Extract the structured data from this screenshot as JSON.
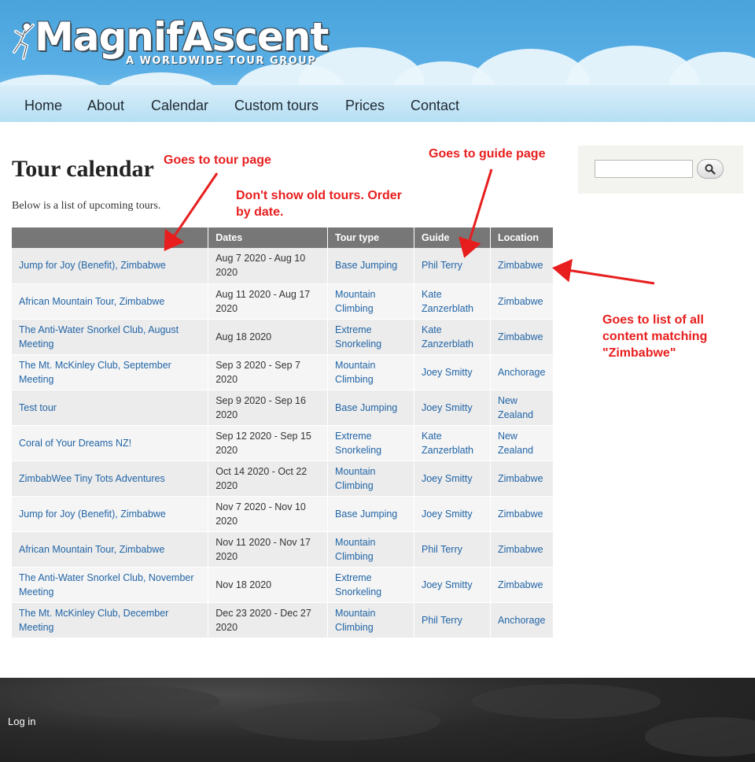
{
  "site": {
    "logo_text": "MagnifAscent",
    "tagline": "A WORLDWIDE TOUR GROUP"
  },
  "nav": [
    "Home",
    "About",
    "Calendar",
    "Custom tours",
    "Prices",
    "Contact"
  ],
  "page": {
    "title": "Tour calendar",
    "intro": "Below is a list of upcoming tours."
  },
  "table": {
    "headers": [
      "",
      "Dates",
      "Tour type",
      "Guide",
      "Location"
    ],
    "rows": [
      {
        "title": "Jump for Joy (Benefit), Zimbabwe",
        "dates": "Aug 7 2020 - Aug 10 2020",
        "type": "Base Jumping",
        "guide": "Phil Terry",
        "location": "Zimbabwe"
      },
      {
        "title": "African Mountain Tour, Zimbabwe",
        "dates": "Aug 11 2020 - Aug 17 2020",
        "type": "Mountain Climbing",
        "guide": "Kate Zanzerblath",
        "location": "Zimbabwe"
      },
      {
        "title": "The Anti-Water Snorkel Club, August Meeting",
        "dates": "Aug 18 2020",
        "type": "Extreme Snorkeling",
        "guide": "Kate Zanzerblath",
        "location": "Zimbabwe"
      },
      {
        "title": "The Mt. McKinley Club, September Meeting",
        "dates": "Sep 3 2020 - Sep 7 2020",
        "type": "Mountain Climbing",
        "guide": "Joey Smitty",
        "location": "Anchorage"
      },
      {
        "title": "Test tour",
        "dates": "Sep 9 2020 - Sep 16 2020",
        "type": "Base Jumping",
        "guide": "Joey Smitty",
        "location": "New Zealand"
      },
      {
        "title": "Coral of Your Dreams NZ!",
        "dates": "Sep 12 2020 - Sep 15 2020",
        "type": "Extreme Snorkeling",
        "guide": "Kate Zanzerblath",
        "location": "New Zealand"
      },
      {
        "title": "ZimbabWee Tiny Tots Adventures",
        "dates": "Oct 14 2020 - Oct 22 2020",
        "type": "Mountain Climbing",
        "guide": "Joey Smitty",
        "location": "Zimbabwe"
      },
      {
        "title": "Jump for Joy (Benefit), Zimbabwe",
        "dates": "Nov 7 2020 - Nov 10 2020",
        "type": "Base Jumping",
        "guide": "Joey Smitty",
        "location": "Zimbabwe"
      },
      {
        "title": "African Mountain Tour, Zimbabwe",
        "dates": "Nov 11 2020 - Nov 17 2020",
        "type": "Mountain Climbing",
        "guide": "Phil Terry",
        "location": "Zimbabwe"
      },
      {
        "title": "The Anti-Water Snorkel Club, November Meeting",
        "dates": "Nov 18 2020",
        "type": "Extreme Snorkeling",
        "guide": "Joey Smitty",
        "location": "Zimbabwe"
      },
      {
        "title": "The Mt. McKinley Club, December Meeting",
        "dates": "Dec 23 2020 - Dec 27 2020",
        "type": "Mountain Climbing",
        "guide": "Phil Terry",
        "location": "Anchorage"
      }
    ]
  },
  "search": {
    "value": "",
    "icon": "search-icon"
  },
  "annotations": {
    "tour_page": "Goes to tour page",
    "guide_page": "Goes to guide page",
    "old_tours_line1": "Don't show old tours. Order",
    "old_tours_line2": "by date.",
    "location_line1": "Goes to list of all",
    "location_line2": "content matching",
    "location_line3": "\"Zimbabwe\""
  },
  "footer": {
    "login": "Log in"
  },
  "colors": {
    "link": "#2265a6",
    "annotation": "#e81e1e",
    "table_header": "#777777",
    "header_sky": "#4aa3dc"
  }
}
